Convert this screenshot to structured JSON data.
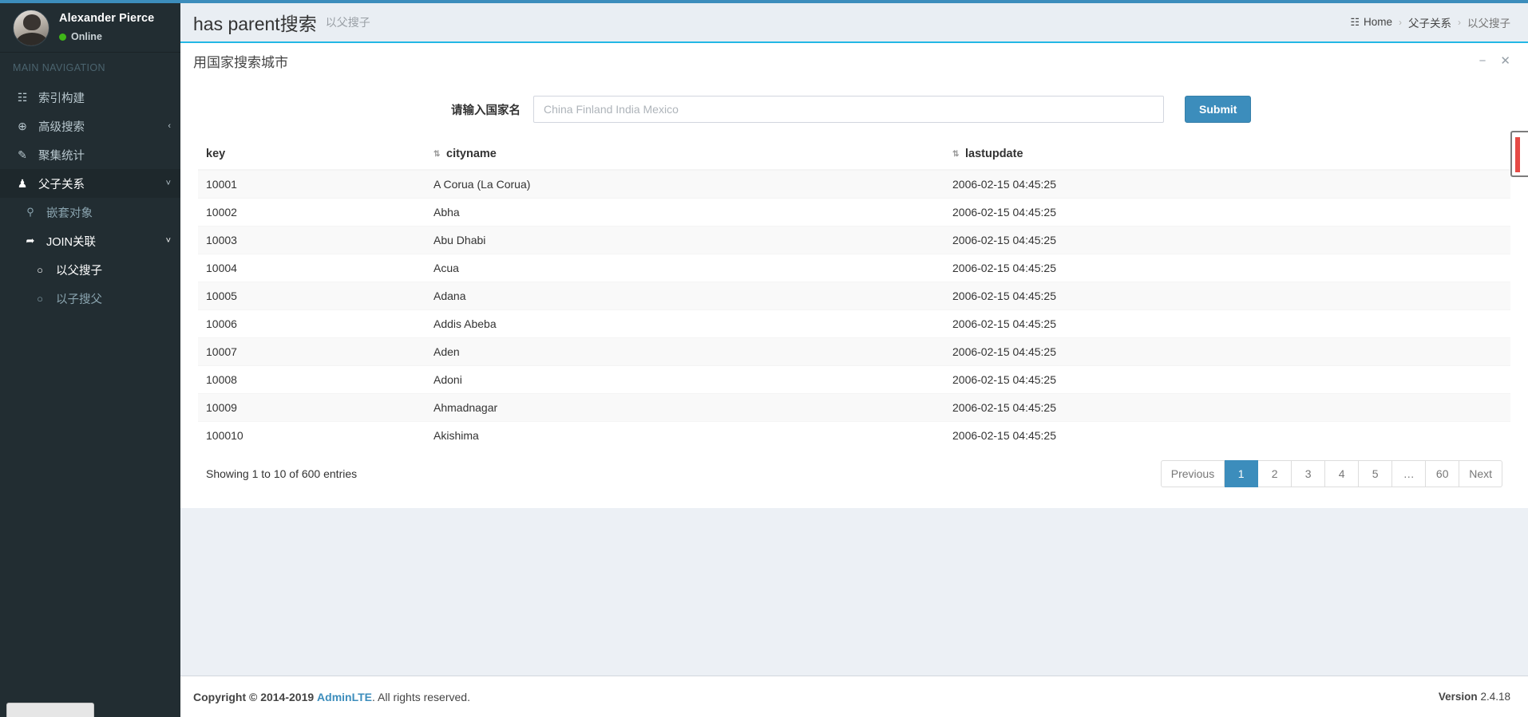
{
  "theme": {
    "accent": "#3c8dbc",
    "header_underline": "#23b7e5",
    "sidebar_bg": "#222d32",
    "online_dot": "#3fb618"
  },
  "sidebar": {
    "user": {
      "name": "Alexander Pierce",
      "status": "Online"
    },
    "nav_header": "MAIN NAVIGATION",
    "items": [
      {
        "label": "索引构建",
        "icon": "calendar-icon",
        "glyph": "☷",
        "caret": ""
      },
      {
        "label": "高级搜索",
        "icon": "search-plus-icon",
        "glyph": "⊕",
        "caret": "‹"
      },
      {
        "label": "聚集统计",
        "icon": "edit-icon",
        "glyph": "✎",
        "caret": ""
      },
      {
        "label": "父子关系",
        "icon": "users-icon",
        "glyph": "♟",
        "caret": "˅"
      }
    ],
    "sub_items": [
      {
        "label": "嵌套对象",
        "icon": "search-icon",
        "glyph": "⚲",
        "caret": "",
        "level": 1,
        "selected": false
      },
      {
        "label": "JOIN关联",
        "icon": "share-arrow-icon",
        "glyph": "➦",
        "caret": "˅",
        "level": 1,
        "selected": false
      },
      {
        "label": "以父搜子",
        "icon": "circle-icon",
        "glyph": "○",
        "caret": "",
        "level": 2,
        "selected": true
      },
      {
        "label": "以子搜父",
        "icon": "circle-icon",
        "glyph": "○",
        "caret": "",
        "level": 2,
        "selected": false
      }
    ]
  },
  "header": {
    "title": "has parent搜索",
    "subtitle": "以父搜子",
    "breadcrumb": {
      "home_icon": "dashboard-icon",
      "home_glyph": "☷",
      "home": "Home",
      "sep": "›",
      "level2": "父子关系",
      "level3": "以父搜子"
    }
  },
  "box": {
    "title": "用国家搜索城市",
    "minimize_glyph": "−",
    "close_glyph": "✕"
  },
  "form": {
    "label": "请输入国家名",
    "value": "",
    "placeholder": "China Finland India Mexico",
    "submit_label": "Submit"
  },
  "table": {
    "columns": [
      {
        "key": "key",
        "label": "key",
        "sort_glyph": ""
      },
      {
        "key": "cityname",
        "label": "cityname",
        "sort_glyph": "⇅"
      },
      {
        "key": "lastupdate",
        "label": "lastupdate",
        "sort_glyph": "⇅"
      }
    ],
    "rows": [
      {
        "key": "10001",
        "cityname": "A Corua (La Corua)",
        "lastupdate": "2006-02-15 04:45:25"
      },
      {
        "key": "10002",
        "cityname": "Abha",
        "lastupdate": "2006-02-15 04:45:25"
      },
      {
        "key": "10003",
        "cityname": "Abu Dhabi",
        "lastupdate": "2006-02-15 04:45:25"
      },
      {
        "key": "10004",
        "cityname": "Acua",
        "lastupdate": "2006-02-15 04:45:25"
      },
      {
        "key": "10005",
        "cityname": "Adana",
        "lastupdate": "2006-02-15 04:45:25"
      },
      {
        "key": "10006",
        "cityname": "Addis Abeba",
        "lastupdate": "2006-02-15 04:45:25"
      },
      {
        "key": "10007",
        "cityname": "Aden",
        "lastupdate": "2006-02-15 04:45:25"
      },
      {
        "key": "10008",
        "cityname": "Adoni",
        "lastupdate": "2006-02-15 04:45:25"
      },
      {
        "key": "10009",
        "cityname": "Ahmadnagar",
        "lastupdate": "2006-02-15 04:45:25"
      },
      {
        "key": "100010",
        "cityname": "Akishima",
        "lastupdate": "2006-02-15 04:45:25"
      }
    ],
    "showing_info": "Showing 1 to 10 of 600 entries",
    "pagination": [
      {
        "label": "Previous",
        "active": false
      },
      {
        "label": "1",
        "active": true
      },
      {
        "label": "2",
        "active": false
      },
      {
        "label": "3",
        "active": false
      },
      {
        "label": "4",
        "active": false
      },
      {
        "label": "5",
        "active": false
      },
      {
        "label": "…",
        "active": false
      },
      {
        "label": "60",
        "active": false
      },
      {
        "label": "Next",
        "active": false
      }
    ]
  },
  "footer": {
    "copyright_prefix": "Copyright © 2014-2019",
    "brand": "AdminLTE",
    "copyright_suffix": ". All rights reserved.",
    "version_label": "Version",
    "version_number": "2.4.18"
  }
}
